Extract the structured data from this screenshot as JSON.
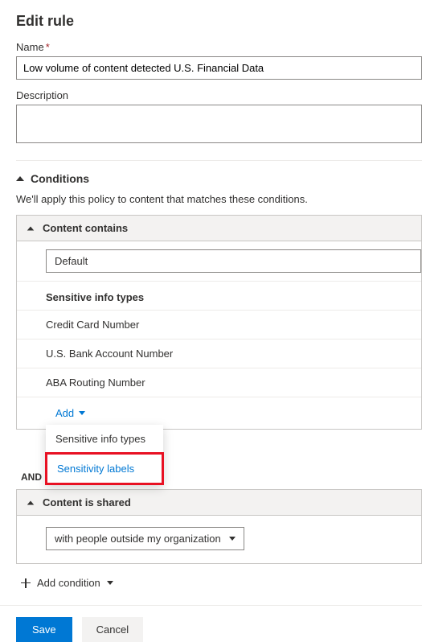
{
  "page_title": "Edit rule",
  "name": {
    "label": "Name",
    "value": "Low volume of content detected U.S. Financial Data"
  },
  "description": {
    "label": "Description",
    "value": ""
  },
  "conditions": {
    "title": "Conditions",
    "desc": "We'll apply this policy to content that matches these conditions.",
    "content_contains": {
      "title": "Content contains",
      "default_label": "Default",
      "group_heading": "Sensitive info types",
      "types": [
        "Credit Card Number",
        "U.S. Bank Account Number",
        "ABA Routing Number"
      ],
      "add_label": "Add",
      "add_menu": {
        "item1": "Sensitive info types",
        "item2": "Sensitivity labels"
      }
    },
    "and_label": "AND",
    "content_shared": {
      "title": "Content is shared",
      "selected": "with people outside my organization"
    },
    "add_condition_label": "Add condition"
  },
  "footer": {
    "save": "Save",
    "cancel": "Cancel"
  }
}
